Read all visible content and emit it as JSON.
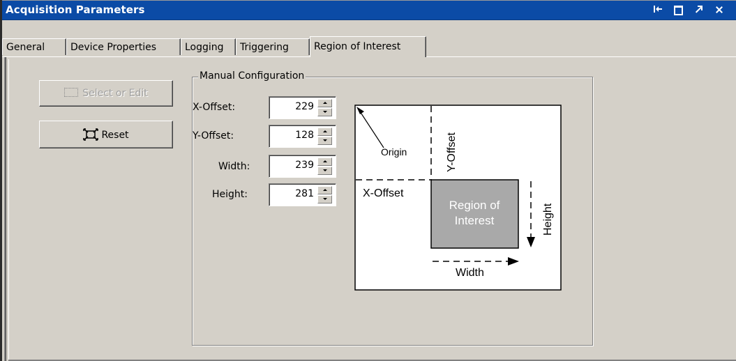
{
  "window": {
    "title": "Acquisition Parameters"
  },
  "titlebar_icons": [
    "undock-icon",
    "maximize-icon",
    "minimize-icon",
    "close-icon"
  ],
  "tabs": [
    {
      "label": "General",
      "active": false
    },
    {
      "label": "Device Properties",
      "active": false
    },
    {
      "label": "Logging",
      "active": false
    },
    {
      "label": "Triggering",
      "active": false
    },
    {
      "label": "Region of Interest",
      "active": true
    }
  ],
  "buttons": {
    "select_label": "Select or Edit",
    "select_enabled": false,
    "reset_label": "Reset"
  },
  "manual": {
    "title": "Manual Configuration",
    "fields": [
      {
        "label": "X-Offset:",
        "value": "229"
      },
      {
        "label": "Y-Offset:",
        "value": "128"
      },
      {
        "label": "Width:",
        "value": "239"
      },
      {
        "label": "Height:",
        "value": "281"
      }
    ]
  },
  "diagram": {
    "origin_label": "Origin",
    "y_offset_label": "Y-Offset",
    "x_offset_label": "X-Offset",
    "roi_line1": "Region of",
    "roi_line2": "Interest",
    "height_label": "Height",
    "width_label": "Width"
  },
  "colors": {
    "titlebar": "#0b4ba6",
    "background": "#d4d0c8",
    "roi_fill": "#a9a9a9"
  }
}
